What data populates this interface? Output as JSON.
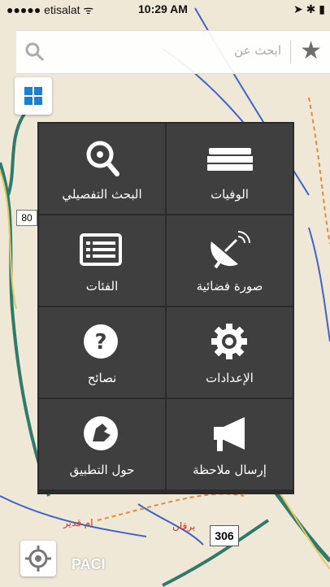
{
  "status_bar": {
    "carrier": "etisalat",
    "time": "10:29 AM"
  },
  "search": {
    "placeholder": "ابحث عن"
  },
  "menu": {
    "tiles": [
      {
        "label": "البحث التفصيلي",
        "icon": "search-location-icon"
      },
      {
        "label": "الوفيات",
        "icon": "casket-icon"
      },
      {
        "label": "الفئات",
        "icon": "list-icon"
      },
      {
        "label": "صورة فضائية",
        "icon": "satellite-dish-icon"
      },
      {
        "label": "نصائح",
        "icon": "help-icon"
      },
      {
        "label": "الإعدادات",
        "icon": "gear-icon"
      },
      {
        "label": "حول التطبيق",
        "icon": "app-logo-icon"
      },
      {
        "label": "إرسال ملاحظة",
        "icon": "megaphone-icon"
      }
    ]
  },
  "map": {
    "road_80": "80",
    "road_306": "306",
    "place_umm_qadir": "ام قدير",
    "place_burgan": "برقان",
    "brand": "PACI"
  },
  "colors": {
    "accent": "#1d7fcf",
    "menu_bg": "#2b2b2b",
    "tile_bg": "#3f3f3f"
  }
}
